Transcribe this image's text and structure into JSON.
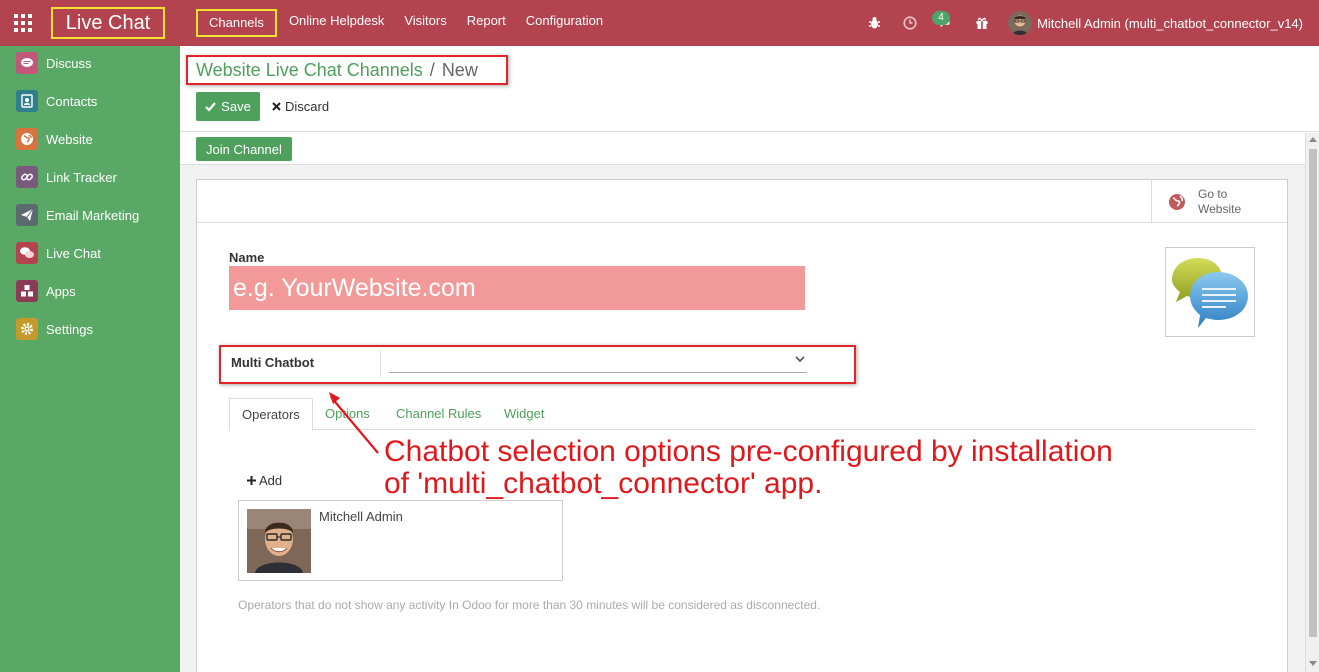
{
  "app": {
    "name": "Live Chat"
  },
  "topnav": {
    "items": [
      {
        "label": "Channels",
        "active": true
      },
      {
        "label": "Online Helpdesk"
      },
      {
        "label": "Visitors"
      },
      {
        "label": "Report"
      },
      {
        "label": "Configuration"
      }
    ],
    "messages_count": "4",
    "user_name": "Mitchell Admin (multi_chatbot_connector_v14)"
  },
  "sidebar": {
    "items": [
      {
        "label": "Discuss",
        "icon": "discuss-icon",
        "color": "#c2577a"
      },
      {
        "label": "Contacts",
        "icon": "contacts-icon",
        "color": "#2f7f8c"
      },
      {
        "label": "Website",
        "icon": "website-icon",
        "color": "#d6733f"
      },
      {
        "label": "Link Tracker",
        "icon": "link-icon",
        "color": "#7a5a7c"
      },
      {
        "label": "Email Marketing",
        "icon": "email-marketing-icon",
        "color": "#5a6a6f"
      },
      {
        "label": "Live Chat",
        "icon": "live-chat-icon",
        "color": "#b3434f"
      },
      {
        "label": "Apps",
        "icon": "apps-icon",
        "color": "#8b3b55"
      },
      {
        "label": "Settings",
        "icon": "settings-icon",
        "color": "#c59a2a"
      }
    ]
  },
  "breadcrumb": {
    "parent": "Website Live Chat Channels",
    "separator": "/",
    "current": "New"
  },
  "actions": {
    "save": "Save",
    "discard": "Discard",
    "join_channel": "Join Channel",
    "go_to_website": [
      "Go to",
      "Website"
    ]
  },
  "form": {
    "name_label": "Name",
    "name_placeholder": "e.g. YourWebsite.com",
    "chatbot_label": "Multi Chatbot",
    "chatbot_value": ""
  },
  "tabs": [
    {
      "label": "Operators",
      "active": true
    },
    {
      "label": "Options"
    },
    {
      "label": "Channel Rules"
    },
    {
      "label": "Widget"
    }
  ],
  "operators": {
    "add_label": "Add",
    "list": [
      {
        "name": "Mitchell Admin"
      }
    ],
    "help": "Operators that do not show any activity In Odoo for more than 30 minutes will be considered as disconnected."
  },
  "annotation": {
    "line1": "Chatbot selection options pre-configured by installation",
    "line2": "of 'multi_chatbot_connector' app."
  },
  "colors": {
    "topbar": "#b3434f",
    "sidebar": "#59a865",
    "primary_button": "#4fa05d",
    "link": "#4e9f5b",
    "highlight_red": "#e0262b",
    "highlight_yellow": "#f5e12f",
    "required_field": "#f29a9a"
  }
}
